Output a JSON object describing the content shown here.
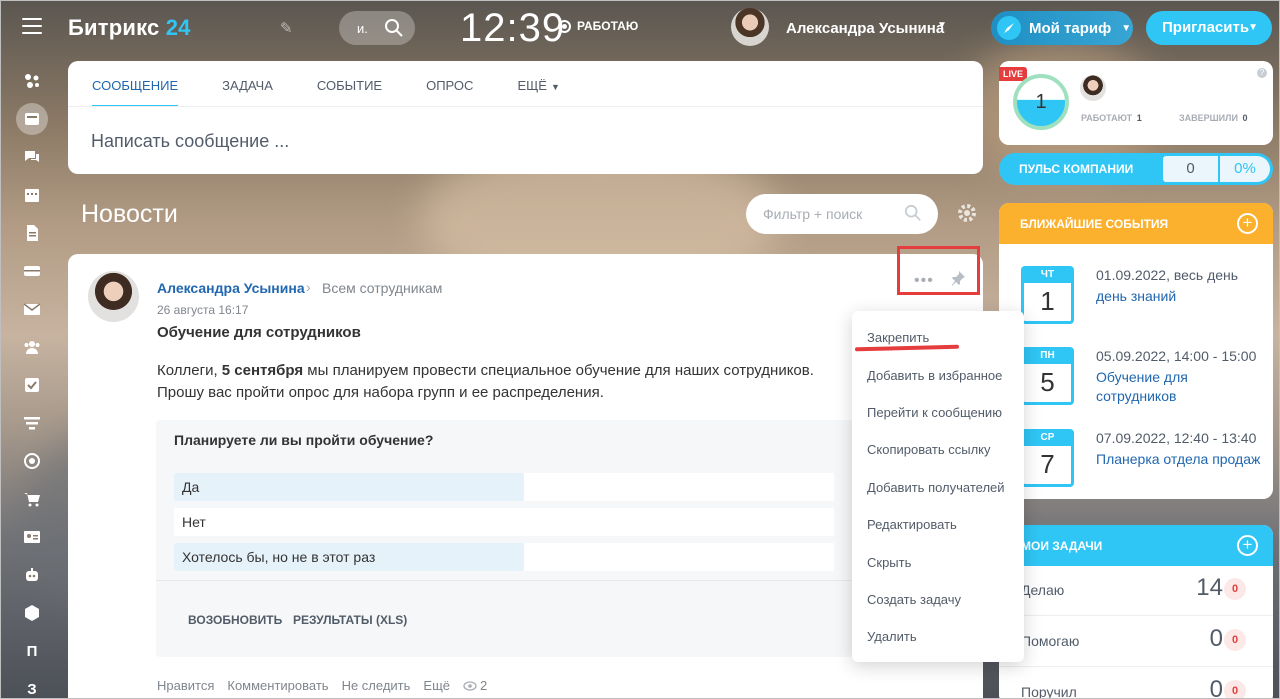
{
  "app": {
    "logo_main": "Битрикс",
    "logo_num": "24"
  },
  "header": {
    "search_placeholder": "и.",
    "clock": "12:39",
    "work_status": "РАБОТАЮ",
    "user_name": "Александра Усынина",
    "tariff_label": "Мой тариф",
    "invite_label": "Пригласить"
  },
  "sidebar": {
    "items": [
      {
        "icon": "feed-icon"
      },
      {
        "icon": "tasks-projects-icon"
      },
      {
        "icon": "chat-icon"
      },
      {
        "icon": "calendar-icon"
      },
      {
        "icon": "documents-icon"
      },
      {
        "icon": "drive-icon"
      },
      {
        "icon": "mail-icon"
      },
      {
        "icon": "groups-icon"
      },
      {
        "icon": "checklist-icon"
      },
      {
        "icon": "crm-funnel-icon"
      },
      {
        "icon": "target-icon"
      },
      {
        "icon": "shop-cart-icon"
      },
      {
        "icon": "contact-card-icon"
      },
      {
        "icon": "robot-icon"
      },
      {
        "icon": "box-icon"
      },
      {
        "label": "П"
      },
      {
        "label": "З"
      }
    ]
  },
  "composer": {
    "tabs": [
      "СООБЩЕНИЕ",
      "ЗАДАЧА",
      "СОБЫТИЕ",
      "ОПРОС",
      "ЕЩЁ"
    ],
    "placeholder": "Написать сообщение ..."
  },
  "news": {
    "title": "Новости",
    "filter_placeholder": "Фильтр + поиск"
  },
  "post": {
    "author": "Александра Усынина",
    "audience": "Всем сотрудникам",
    "date": "26 августа 16:17",
    "title": "Обучение для сотрудников",
    "body_pre": "Коллеги, ",
    "body_bold": "5 сентября",
    "body_post": " мы планируем провести специальное обучение для наших сотрудников.",
    "body_line2": "Прошу вас пройти опрос для набора групп и ее распределения.",
    "poll": {
      "question": "Планируете ли вы пройти обучение?",
      "options": [
        {
          "label": "Да",
          "share": 0.53
        },
        {
          "label": "Нет",
          "share": 0
        },
        {
          "label": "Хотелось бы, но не в этот раз",
          "share": 0.53
        }
      ],
      "resume_label": "ВОЗОБНОВИТЬ",
      "results_label": "РЕЗУЛЬТАТЫ (XLS)"
    },
    "footer": {
      "like": "Нравится",
      "comment": "Комментировать",
      "unfollow": "Не следить",
      "more": "Ещё",
      "views": "2"
    }
  },
  "context_menu": {
    "items": [
      "Закрепить",
      "Добавить в избранное",
      "Перейти к сообщению",
      "Скопировать ссылку",
      "Добавить получателей",
      "Редактировать",
      "Скрыть",
      "Создать задачу",
      "Удалить"
    ]
  },
  "live": {
    "badge": "LIVE",
    "count": "1",
    "working_label": "РАБОТАЮТ",
    "working_value": "1",
    "done_label": "ЗАВЕРШИЛИ",
    "done_value": "0"
  },
  "pulse": {
    "label": "ПУЛЬС КОМПАНИИ",
    "value": "0",
    "percent": "0%"
  },
  "events": {
    "title": "БЛИЖАЙШИЕ СОБЫТИЯ",
    "items": [
      {
        "day": "ЧТ",
        "num": "1",
        "when": "01.09.2022, весь день",
        "what": "день знаний"
      },
      {
        "day": "ПН",
        "num": "5",
        "when": "05.09.2022, 14:00 - 15:00",
        "what": "Обучение для сотрудников"
      },
      {
        "day": "СР",
        "num": "7",
        "when": "07.09.2022, 12:40 - 13:40",
        "what": "Планерка отдела продаж"
      }
    ]
  },
  "tasks": {
    "title": "МОИ ЗАДАЧИ",
    "rows": [
      {
        "name": "Делаю",
        "count": "14",
        "badge": "0"
      },
      {
        "name": "Помогаю",
        "count": "0",
        "badge": "0"
      },
      {
        "name": "Поручил",
        "count": "0",
        "badge": "0"
      }
    ]
  },
  "colors": {
    "accent": "#2fc6f6",
    "link": "#2067b0",
    "events": "#fbb12d",
    "highlight": "#e53d3d"
  }
}
